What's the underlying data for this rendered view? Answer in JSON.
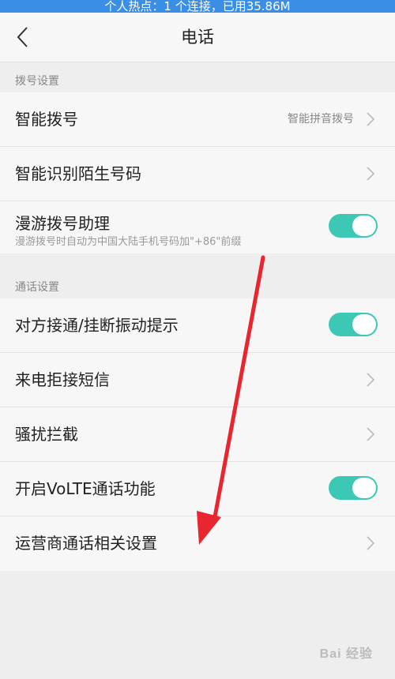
{
  "status_bar": {
    "text": "个人热点：1 个连接，已用35.86M"
  },
  "header": {
    "title": "电话",
    "back_icon": "back-chevron-icon"
  },
  "sections": [
    {
      "title": "拨号设置",
      "items": [
        {
          "label": "智能拨号",
          "value": "智能拼音拨号",
          "control": "chevron"
        },
        {
          "label": "智能识别陌生号码",
          "control": "chevron"
        },
        {
          "label": "漫游拨号助理",
          "sublabel": "漫游拨号时自动为中国大陆手机号码加\"+86\"前缀",
          "control": "toggle",
          "on": true
        }
      ]
    },
    {
      "title": "通话设置",
      "items": [
        {
          "label": "对方接通/挂断振动提示",
          "control": "toggle",
          "on": true
        },
        {
          "label": "来电拒接短信",
          "control": "chevron"
        },
        {
          "label": "骚扰拦截",
          "control": "chevron"
        },
        {
          "label": "开启VoLTE通话功能",
          "control": "toggle",
          "on": true
        },
        {
          "label": "运营商通话相关设置",
          "control": "chevron"
        }
      ]
    }
  ],
  "annotation": {
    "color": "#e8262f"
  },
  "watermark": {
    "text": "Bai 经验"
  },
  "colors": {
    "toggle_on": "#3cc8b4",
    "status_bar": "#3a8ee6"
  }
}
